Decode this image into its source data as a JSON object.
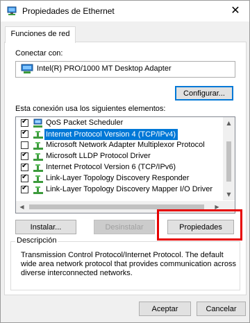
{
  "window": {
    "title": "Propiedades de Ethernet",
    "close_glyph": "✕"
  },
  "tabs": [
    {
      "label": "Funciones de red"
    }
  ],
  "connect_using": {
    "label": "Conectar con:",
    "adapter": "Intel(R) PRO/1000 MT Desktop Adapter",
    "configure_button": "Configurar..."
  },
  "items_label": "Esta conexión usa los siguientes elementos:",
  "items": [
    {
      "label": "QoS Packet Scheduler",
      "checked": true,
      "selected": false,
      "icon": "service-icon"
    },
    {
      "label": "Internet Protocol Version 4 (TCP/IPv4)",
      "checked": true,
      "selected": true,
      "icon": "protocol-icon"
    },
    {
      "label": "Microsoft Network Adapter Multiplexor Protocol",
      "checked": false,
      "selected": false,
      "icon": "protocol-icon"
    },
    {
      "label": "Microsoft LLDP Protocol Driver",
      "checked": true,
      "selected": false,
      "icon": "protocol-icon"
    },
    {
      "label": "Internet Protocol Version 6 (TCP/IPv6)",
      "checked": true,
      "selected": false,
      "icon": "protocol-icon"
    },
    {
      "label": "Link-Layer Topology Discovery Responder",
      "checked": true,
      "selected": false,
      "icon": "protocol-icon"
    },
    {
      "label": "Link-Layer Topology Discovery Mapper I/O Driver",
      "checked": true,
      "selected": false,
      "icon": "protocol-icon"
    }
  ],
  "buttons": {
    "install": "Instalar...",
    "uninstall": "Desinstalar",
    "properties": "Propiedades"
  },
  "description": {
    "legend": "Descripción",
    "text": "Transmission Control Protocol/Internet Protocol. The default wide area network protocol that provides communication across diverse interconnected networks."
  },
  "footer": {
    "ok": "Aceptar",
    "cancel": "Cancelar"
  },
  "colors": {
    "selection": "#0078d7",
    "highlight_annotation": "#e60000"
  }
}
